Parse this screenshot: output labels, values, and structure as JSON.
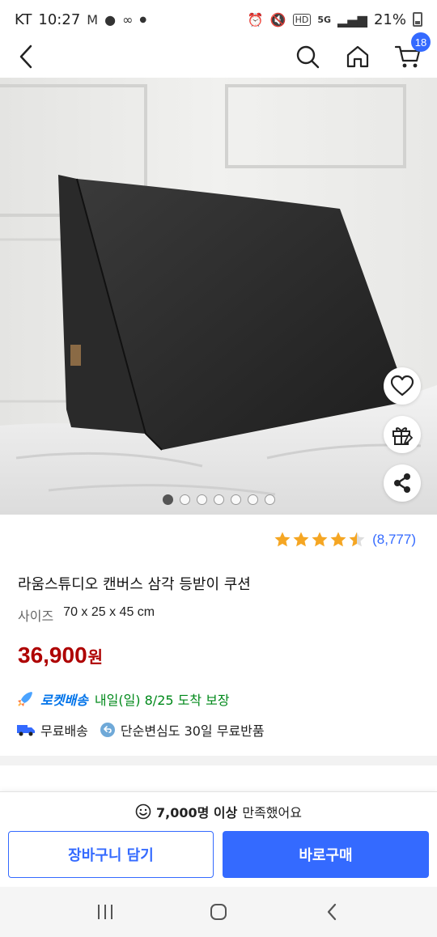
{
  "status_bar": {
    "carrier": "KT",
    "time": "10:27",
    "network": "5G",
    "battery": "21%"
  },
  "header": {
    "cart_count": "18"
  },
  "gallery": {
    "total_images": 7,
    "active_index": 0
  },
  "rating": {
    "stars": 4.5,
    "count": "(8,777)",
    "star_color": "#f5a623"
  },
  "product": {
    "title": "라움스튜디오 캔버스 삼각 등받이 쿠션",
    "option_label": "사이즈",
    "option_value": "70 x 25 x 45 cm",
    "price": "36,900",
    "price_unit": "원",
    "price_color": "#ae0000"
  },
  "delivery": {
    "rocket_label": "로켓배송",
    "eta": "내일(일) 8/25 도착 보장",
    "free_shipping": "무료배송",
    "free_return": "단순변심도 30일 무료반품"
  },
  "purchase_bar": {
    "satisfaction_strong": "7,000명 이상",
    "satisfaction_rest": "만족했어요",
    "add_to_cart_label": "장바구니 담기",
    "buy_now_label": "바로구매",
    "accent_color": "#346aff"
  }
}
